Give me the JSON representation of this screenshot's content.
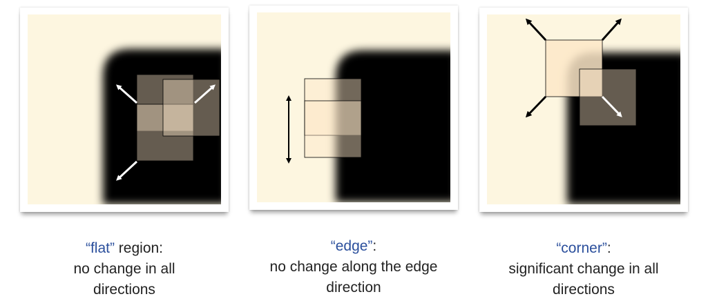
{
  "panels": [
    {
      "keyword": "“flat”",
      "line1_rest": " region:",
      "line2": "no change in all",
      "line3": "directions"
    },
    {
      "keyword": "“edge”",
      "line1_rest": ":",
      "line2": "no change along the edge",
      "line3": "direction"
    },
    {
      "keyword": "“corner”",
      "line1_rest": ":",
      "line2": "significant change in all",
      "line3": "directions"
    }
  ],
  "colors": {
    "background": "#fdf6e0",
    "shape": "#000000",
    "window_fill": "#fde7c8",
    "caption_keyword": "#2b4f9c",
    "caption_text": "#222222",
    "arrow_white": "#ffffff",
    "arrow_black": "#000000"
  }
}
